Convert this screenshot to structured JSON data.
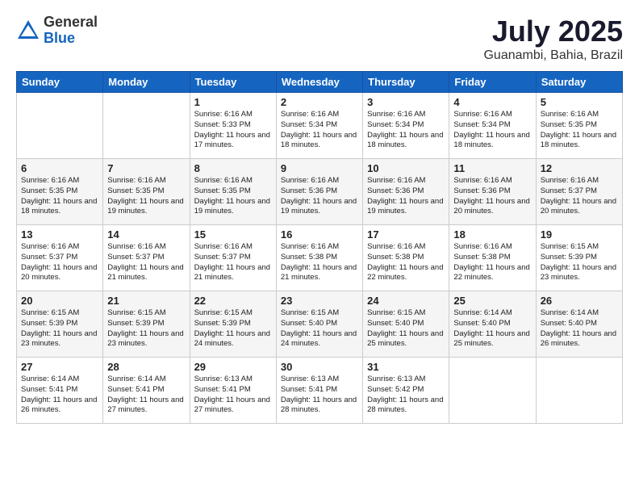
{
  "logo": {
    "general": "General",
    "blue": "Blue"
  },
  "title": "July 2025",
  "location": "Guanambi, Bahia, Brazil",
  "days_of_week": [
    "Sunday",
    "Monday",
    "Tuesday",
    "Wednesday",
    "Thursday",
    "Friday",
    "Saturday"
  ],
  "weeks": [
    [
      {
        "day": "",
        "info": ""
      },
      {
        "day": "",
        "info": ""
      },
      {
        "day": "1",
        "info": "Sunrise: 6:16 AM\nSunset: 5:33 PM\nDaylight: 11 hours and 17 minutes."
      },
      {
        "day": "2",
        "info": "Sunrise: 6:16 AM\nSunset: 5:34 PM\nDaylight: 11 hours and 18 minutes."
      },
      {
        "day": "3",
        "info": "Sunrise: 6:16 AM\nSunset: 5:34 PM\nDaylight: 11 hours and 18 minutes."
      },
      {
        "day": "4",
        "info": "Sunrise: 6:16 AM\nSunset: 5:34 PM\nDaylight: 11 hours and 18 minutes."
      },
      {
        "day": "5",
        "info": "Sunrise: 6:16 AM\nSunset: 5:35 PM\nDaylight: 11 hours and 18 minutes."
      }
    ],
    [
      {
        "day": "6",
        "info": "Sunrise: 6:16 AM\nSunset: 5:35 PM\nDaylight: 11 hours and 18 minutes."
      },
      {
        "day": "7",
        "info": "Sunrise: 6:16 AM\nSunset: 5:35 PM\nDaylight: 11 hours and 19 minutes."
      },
      {
        "day": "8",
        "info": "Sunrise: 6:16 AM\nSunset: 5:35 PM\nDaylight: 11 hours and 19 minutes."
      },
      {
        "day": "9",
        "info": "Sunrise: 6:16 AM\nSunset: 5:36 PM\nDaylight: 11 hours and 19 minutes."
      },
      {
        "day": "10",
        "info": "Sunrise: 6:16 AM\nSunset: 5:36 PM\nDaylight: 11 hours and 19 minutes."
      },
      {
        "day": "11",
        "info": "Sunrise: 6:16 AM\nSunset: 5:36 PM\nDaylight: 11 hours and 20 minutes."
      },
      {
        "day": "12",
        "info": "Sunrise: 6:16 AM\nSunset: 5:37 PM\nDaylight: 11 hours and 20 minutes."
      }
    ],
    [
      {
        "day": "13",
        "info": "Sunrise: 6:16 AM\nSunset: 5:37 PM\nDaylight: 11 hours and 20 minutes."
      },
      {
        "day": "14",
        "info": "Sunrise: 6:16 AM\nSunset: 5:37 PM\nDaylight: 11 hours and 21 minutes."
      },
      {
        "day": "15",
        "info": "Sunrise: 6:16 AM\nSunset: 5:37 PM\nDaylight: 11 hours and 21 minutes."
      },
      {
        "day": "16",
        "info": "Sunrise: 6:16 AM\nSunset: 5:38 PM\nDaylight: 11 hours and 21 minutes."
      },
      {
        "day": "17",
        "info": "Sunrise: 6:16 AM\nSunset: 5:38 PM\nDaylight: 11 hours and 22 minutes."
      },
      {
        "day": "18",
        "info": "Sunrise: 6:16 AM\nSunset: 5:38 PM\nDaylight: 11 hours and 22 minutes."
      },
      {
        "day": "19",
        "info": "Sunrise: 6:15 AM\nSunset: 5:39 PM\nDaylight: 11 hours and 23 minutes."
      }
    ],
    [
      {
        "day": "20",
        "info": "Sunrise: 6:15 AM\nSunset: 5:39 PM\nDaylight: 11 hours and 23 minutes."
      },
      {
        "day": "21",
        "info": "Sunrise: 6:15 AM\nSunset: 5:39 PM\nDaylight: 11 hours and 23 minutes."
      },
      {
        "day": "22",
        "info": "Sunrise: 6:15 AM\nSunset: 5:39 PM\nDaylight: 11 hours and 24 minutes."
      },
      {
        "day": "23",
        "info": "Sunrise: 6:15 AM\nSunset: 5:40 PM\nDaylight: 11 hours and 24 minutes."
      },
      {
        "day": "24",
        "info": "Sunrise: 6:15 AM\nSunset: 5:40 PM\nDaylight: 11 hours and 25 minutes."
      },
      {
        "day": "25",
        "info": "Sunrise: 6:14 AM\nSunset: 5:40 PM\nDaylight: 11 hours and 25 minutes."
      },
      {
        "day": "26",
        "info": "Sunrise: 6:14 AM\nSunset: 5:40 PM\nDaylight: 11 hours and 26 minutes."
      }
    ],
    [
      {
        "day": "27",
        "info": "Sunrise: 6:14 AM\nSunset: 5:41 PM\nDaylight: 11 hours and 26 minutes."
      },
      {
        "day": "28",
        "info": "Sunrise: 6:14 AM\nSunset: 5:41 PM\nDaylight: 11 hours and 27 minutes."
      },
      {
        "day": "29",
        "info": "Sunrise: 6:13 AM\nSunset: 5:41 PM\nDaylight: 11 hours and 27 minutes."
      },
      {
        "day": "30",
        "info": "Sunrise: 6:13 AM\nSunset: 5:41 PM\nDaylight: 11 hours and 28 minutes."
      },
      {
        "day": "31",
        "info": "Sunrise: 6:13 AM\nSunset: 5:42 PM\nDaylight: 11 hours and 28 minutes."
      },
      {
        "day": "",
        "info": ""
      },
      {
        "day": "",
        "info": ""
      }
    ]
  ]
}
